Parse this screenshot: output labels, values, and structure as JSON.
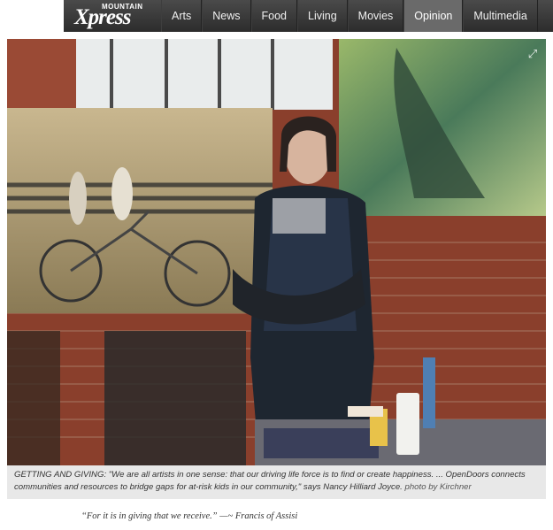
{
  "site": {
    "logo_small": "MOUNTAIN",
    "logo_big": "Xpress"
  },
  "nav": {
    "items": [
      {
        "label": "Arts",
        "active": false
      },
      {
        "label": "News",
        "active": false
      },
      {
        "label": "Food",
        "active": false
      },
      {
        "label": "Living",
        "active": false
      },
      {
        "label": "Movies",
        "active": false
      },
      {
        "label": "Opinion",
        "active": true
      },
      {
        "label": "Multimedia",
        "active": false
      }
    ]
  },
  "photo": {
    "expand_icon": "expand-icon"
  },
  "caption": {
    "text": "GETTING AND GIVING: \"We are all artists in one sense: that our driving life force is to find or create happiness. ... OpenDoors connects communities and resources to bridge gaps for at-risk kids in our community,\" says Nancy Hilliard Joyce.",
    "credit": "photo by Kirchner"
  },
  "quote": {
    "text": "“For it is in giving that we receive.” —~ Francis of Assisi"
  }
}
